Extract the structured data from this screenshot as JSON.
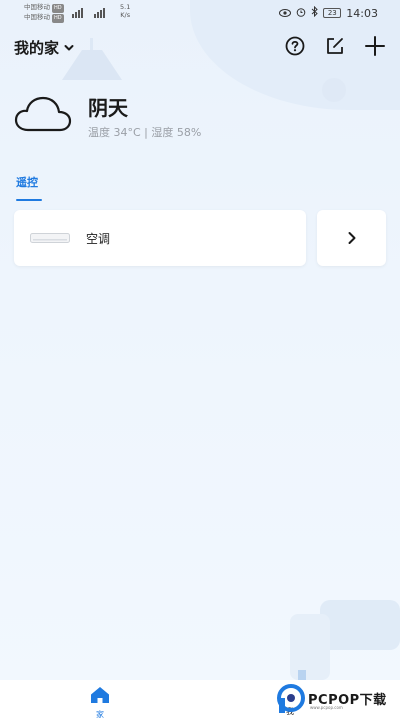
{
  "status_bar": {
    "carrier_1": "中国移动",
    "carrier_2": "中国移动",
    "hd_badge": "HD",
    "signal_label": "4G",
    "net_speed": "5.1",
    "net_unit": "K/s",
    "battery": "23",
    "time": "14:03"
  },
  "header": {
    "home_name": "我的家"
  },
  "weather": {
    "condition": "阴天",
    "detail": "温度 34°C | 湿度 58%"
  },
  "tabs": [
    {
      "label": "遥控",
      "active": true
    }
  ],
  "devices": [
    {
      "name": "空调",
      "icon": "air-conditioner-icon"
    }
  ],
  "bottom_nav": {
    "home_label": "家",
    "me_label": "我"
  },
  "watermark": {
    "text": "PCPOP下载",
    "sub": "www.pcpop.com"
  },
  "colors": {
    "accent": "#1f7ae0",
    "background": "#eaf2fb"
  }
}
